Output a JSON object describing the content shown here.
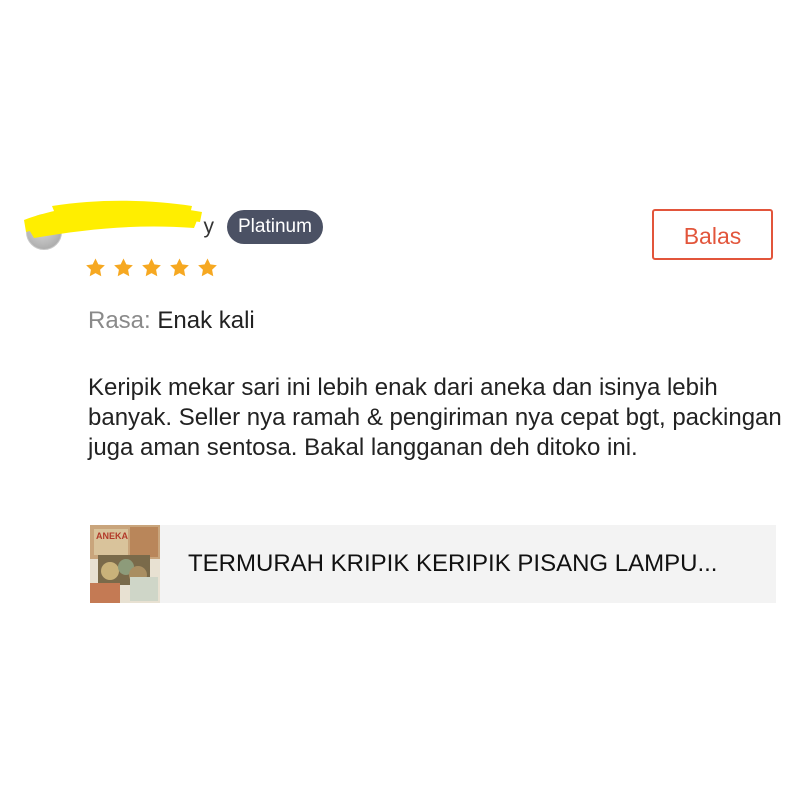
{
  "review": {
    "username": "y",
    "tier_badge": "Platinum",
    "reply_label": "Balas",
    "rating": 5,
    "rating_max": 5,
    "attribute": {
      "label": "Rasa:",
      "value": "Enak kali"
    },
    "text": "Keripik mekar sari ini lebih enak dari aneka dan isinya lebih banyak. Seller nya ramah & pengiriman nya cepat bgt, packingan juga aman sentosa. Bakal langganan deh ditoko ini.",
    "product": {
      "name": "TERMURAH KRIPIK KERIPIK PISANG LAMPU...",
      "thumbnail_text": "ANEKA"
    }
  },
  "colors": {
    "accent": "#e2553b",
    "badge_bg": "#4b5164",
    "star": "#f6a821",
    "card_bg": "#f3f3f3",
    "redaction": "#ffee00"
  }
}
